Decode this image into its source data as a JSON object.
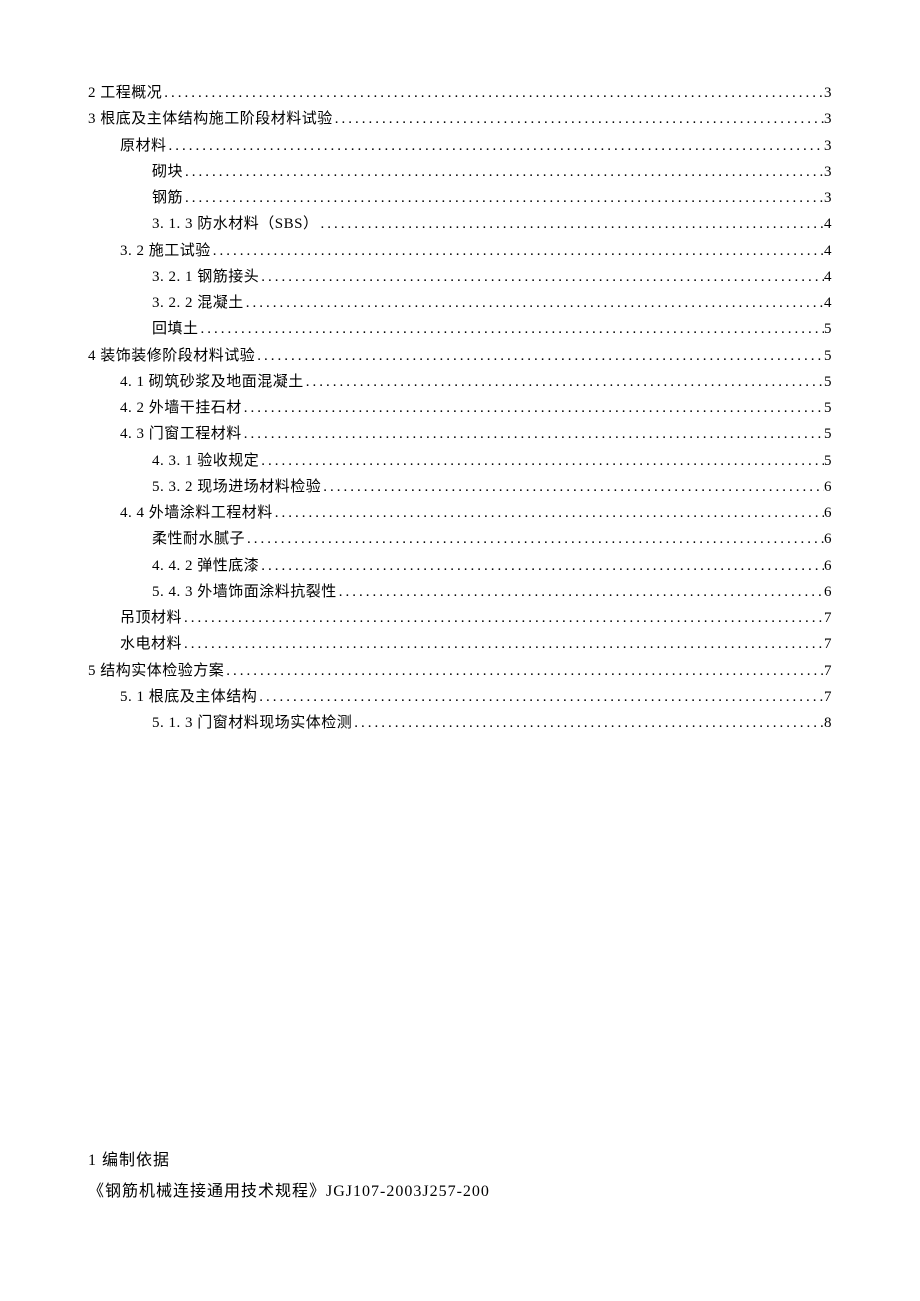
{
  "toc": [
    {
      "text": "2 工程概况 ",
      "page": " 3",
      "indent": 0
    },
    {
      "text": "3 根底及主体结构施工阶段材料试验 ",
      "page": " 3",
      "indent": 0
    },
    {
      "text": "原材料",
      "page": " 3",
      "indent": 1
    },
    {
      "text": "砌块",
      "page": " 3",
      "indent": 2
    },
    {
      "text": "钢筋",
      "page": " 3",
      "indent": 2
    },
    {
      "text": "3.  1. 3 防水材料（SBS）",
      "page": " 4",
      "indent": 2
    },
    {
      "text": "3. 2 施工试验 ",
      "page": " 4",
      "indent": 1
    },
    {
      "text": "3. 2. 1 钢筋接头 ",
      "page": " 4",
      "indent": 2
    },
    {
      "text": "3. 2. 2 混凝土 ",
      "page": " 4",
      "indent": 2
    },
    {
      "text": "回填土",
      "page": " 5",
      "indent": 2
    },
    {
      "text": "4 装饰装修阶段材料试验 ",
      "page": " 5",
      "indent": 0
    },
    {
      "text": "4. 1 砌筑砂浆及地面混凝土 ",
      "page": " 5",
      "indent": 1
    },
    {
      "text": "4. 2 外墙干挂石材 ",
      "page": " 5",
      "indent": 1
    },
    {
      "text": "4. 3 门窗工程材料 ",
      "page": " 5",
      "indent": 1
    },
    {
      "text": "4.  3. 1 验收规定",
      "page": " 5",
      "indent": 2
    },
    {
      "text": "5.  3. 2 现场进场材料检验",
      "page": " 6",
      "indent": 2
    },
    {
      "text": "4. 4 外墙涂料工程材料 ",
      "page": " 6",
      "indent": 1
    },
    {
      "text": "柔性耐水腻子",
      "page": " 6",
      "indent": 2
    },
    {
      "text": "4.  4. 2 弹性底漆",
      "page": " 6",
      "indent": 2
    },
    {
      "text": "5.  4. 3 外墙饰面涂料抗裂性",
      "page": " 6",
      "indent": 2
    },
    {
      "text": "吊顶材料",
      "page": " 7",
      "indent": 1
    },
    {
      "text": "水电材料",
      "page": " 7",
      "indent": 1
    },
    {
      "text": "5 结构实体检验方案 ",
      "page": " 7",
      "indent": 0
    },
    {
      "text": "5. 1  根底及主体结构",
      "page": " 7",
      "indent": 1
    },
    {
      "text": "5.  1. 3 门窗材料现场实体检测",
      "page": " 8",
      "indent": 2
    }
  ],
  "body": {
    "heading": "1 编制依据",
    "line1": "《钢筋机械连接通用技术规程》JGJ107-2003J257-200"
  }
}
